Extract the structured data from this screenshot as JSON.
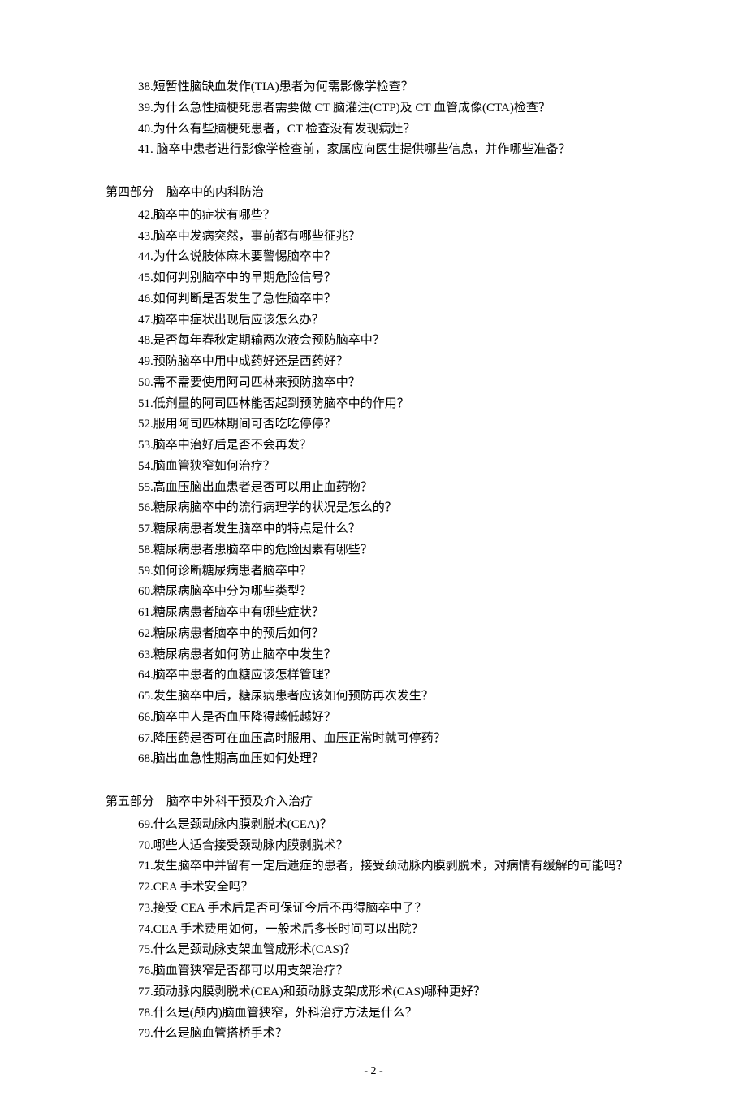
{
  "top_questions": [
    "38.短暂性脑缺血发作(TIA)患者为何需影像学检查？",
    "39.为什么急性脑梗死患者需要做 CT 脑灌注(CTP)及 CT 血管成像(CTA)检查？",
    "40.为什么有些脑梗死患者，CT 检查没有发现病灶？",
    "41. 脑卒中患者进行影像学检查前，家属应向医生提供哪些信息，并作哪些准备？"
  ],
  "section4": {
    "title": "第四部分　脑卒中的内科防治",
    "questions": [
      "42.脑卒中的症状有哪些？",
      "43.脑卒中发病突然，事前都有哪些征兆？",
      "44.为什么说肢体麻木要警惕脑卒中？",
      "45.如何判别脑卒中的早期危险信号？",
      "46.如何判断是否发生了急性脑卒中？",
      "47.脑卒中症状出现后应该怎么办？",
      "48.是否每年春秋定期输两次液会预防脑卒中？",
      "49.预防脑卒中用中成药好还是西药好？",
      "50.需不需要使用阿司匹林来预防脑卒中？",
      "51.低剂量的阿司匹林能否起到预防脑卒中的作用？",
      "52.服用阿司匹林期间可否吃吃停停？",
      "53.脑卒中治好后是否不会再发？",
      "54.脑血管狭窄如何治疗？",
      "55.高血压脑出血患者是否可以用止血药物？",
      "56.糖尿病脑卒中的流行病理学的状况是怎么的？",
      "57.糖尿病患者发生脑卒中的特点是什么？",
      "58.糖尿病患者患脑卒中的危险因素有哪些？",
      "59.如何诊断糖尿病患者脑卒中？",
      "60.糖尿病脑卒中分为哪些类型？",
      "61.糖尿病患者脑卒中有哪些症状？",
      "62.糖尿病患者脑卒中的预后如何？",
      "63.糖尿病患者如何防止脑卒中发生？",
      "64.脑卒中患者的血糖应该怎样管理？",
      "65.发生脑卒中后，糖尿病患者应该如何预防再次发生？",
      "66.脑卒中人是否血压降得越低越好？",
      "67.降压药是否可在血压高时服用、血压正常时就可停药？",
      "68.脑出血急性期高血压如何处理？"
    ]
  },
  "section5": {
    "title": "第五部分　脑卒中外科干预及介入治疗",
    "questions": [
      "69.什么是颈动脉内膜剥脱术(CEA)？",
      "70.哪些人适合接受颈动脉内膜剥脱术？",
      "71.发生脑卒中并留有一定后遗症的患者，接受颈动脉内膜剥脱术，对病情有缓解的可能吗？",
      "72.CEA 手术安全吗？",
      "73.接受 CEA 手术后是否可保证今后不再得脑卒中了？",
      "74.CEA 手术费用如何，一般术后多长时间可以出院？",
      "75.什么是颈动脉支架血管成形术(CAS)？",
      "76.脑血管狭窄是否都可以用支架治疗？",
      "77.颈动脉内膜剥脱术(CEA)和颈动脉支架成形术(CAS)哪种更好？",
      "78.什么是(颅内)脑血管狭窄，外科治疗方法是什么？",
      "79.什么是脑血管搭桥手术？"
    ]
  },
  "page_number": "- 2 -"
}
